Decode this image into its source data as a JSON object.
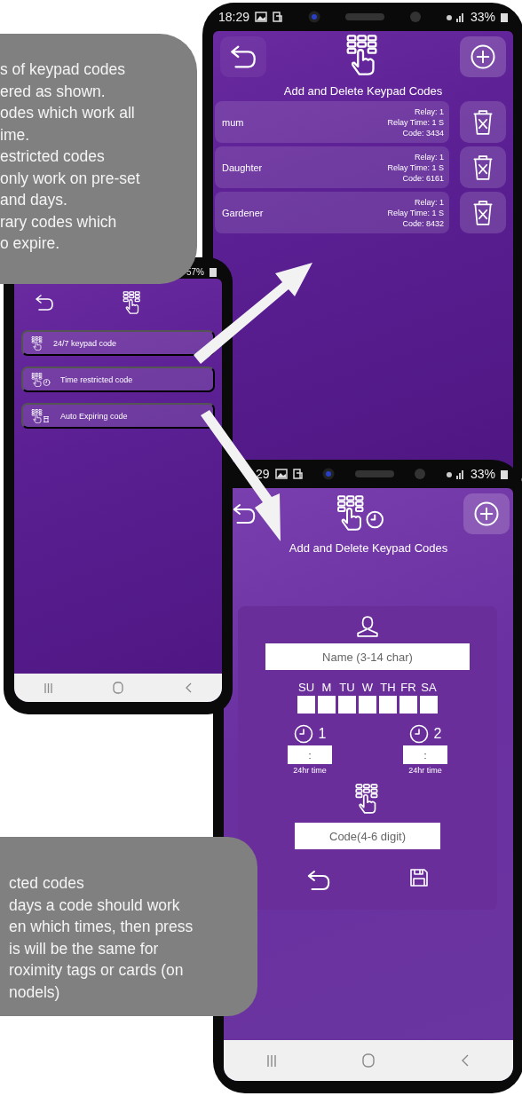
{
  "callouts": [
    {
      "lines": [
        "s of keypad codes",
        "ered as shown.",
        "odes which work all",
        "ime.",
        "estricted codes",
        "only work on pre-set",
        "and days.",
        "rary codes which",
        "o expire."
      ]
    },
    {
      "lines": [
        "cted codes",
        "days a code should work",
        "en which times, then press",
        "is will be the same for",
        "roximity tags or cards (on",
        "nodels)"
      ]
    }
  ],
  "codes_screen": {
    "status_bar": {
      "time": "18:29",
      "battery": "33%"
    },
    "title": "Add and Delete Keypad Codes",
    "codes": [
      {
        "name": "mum",
        "relay": "Relay: 1",
        "relay_time": "Relay Time: 1 S",
        "code": "Code: 3434"
      },
      {
        "name": "Daughter",
        "relay": "Relay: 1",
        "relay_time": "Relay Time: 1 S",
        "code": "Code: 6161"
      },
      {
        "name": "Gardener",
        "relay": "Relay: 1",
        "relay_time": "Relay Time: 1 S",
        "code": "Code: 8432"
      }
    ]
  },
  "menu_screen": {
    "status_bar": {
      "battery": "57%"
    },
    "options": [
      {
        "kind": "always",
        "label": "24/7 keypad code"
      },
      {
        "kind": "timed",
        "label": "Time restricted code"
      },
      {
        "kind": "expiring",
        "label": "Auto Expiring code"
      }
    ]
  },
  "form_screen": {
    "status_bar": {
      "time": "29",
      "battery": "33%"
    },
    "title": "Add and Delete Keypad Codes",
    "name_placeholder": "Name (3-14 char)",
    "days": [
      {
        "label": "SU",
        "checked": false
      },
      {
        "label": "M",
        "checked": false
      },
      {
        "label": "TU",
        "checked": false
      },
      {
        "label": "W",
        "checked": false
      },
      {
        "label": "TH",
        "checked": false
      },
      {
        "label": "FR",
        "checked": false
      },
      {
        "label": "SA",
        "checked": false
      }
    ],
    "times": [
      {
        "label": "1",
        "value": ":",
        "hint": "24hr time"
      },
      {
        "label": "2",
        "value": ":",
        "hint": "24hr time"
      }
    ],
    "code_placeholder": "Code(4-6 digit)"
  }
}
